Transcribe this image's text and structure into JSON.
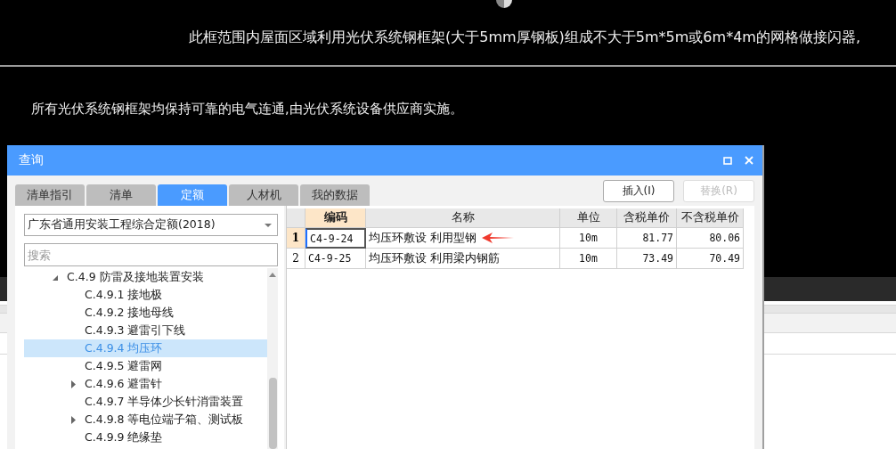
{
  "drawing": {
    "notes": [
      "此框范围内屋面区域利用光伏系统钢框架(大于5mm厚钢板)组成不大于5m*5m或6m*4m的网格做接闪器,",
      "所有光伏系统钢框架均保持可靠的电气连通,由光伏系统设备供应商实施。"
    ]
  },
  "dialog": {
    "title": "查询",
    "tabs": [
      {
        "label": "清单指引",
        "selected": false
      },
      {
        "label": "清单",
        "selected": false
      },
      {
        "label": "定额",
        "selected": true
      },
      {
        "label": "人材机",
        "selected": false
      },
      {
        "label": "我的数据",
        "selected": false
      }
    ],
    "buttons": [
      {
        "label": "插入(I)",
        "disabled": false
      },
      {
        "label": "替换(R)",
        "disabled": true
      }
    ],
    "library": {
      "value": "广东省通用安装工程综合定额(2018)"
    },
    "search": {
      "placeholder": "搜索"
    },
    "tree": [
      {
        "label": "C.4.9 防雷及接地装置安装",
        "expanded": true,
        "selected": false,
        "children": [
          {
            "label": "C.4.9.1 接地极",
            "selected": false
          },
          {
            "label": "C.4.9.2 接地母线",
            "selected": false
          },
          {
            "label": "C.4.9.3 避雷引下线",
            "selected": false
          },
          {
            "label": "C.4.9.4 均压环",
            "selected": true
          },
          {
            "label": "C.4.9.5 避雷网",
            "selected": false
          },
          {
            "label": "C.4.9.6 避雷针",
            "selected": false,
            "expanded": false
          },
          {
            "label": "C.4.9.7 半导体少长针消雷装置",
            "selected": false
          },
          {
            "label": "C.4.9.8 等电位端子箱、测试板",
            "selected": false,
            "expanded": false
          },
          {
            "label": "C.4.9.9 绝缘垫",
            "selected": false
          }
        ]
      }
    ],
    "table": {
      "columns": [
        "编码",
        "名称",
        "单位",
        "含税单价",
        "不含税单价"
      ],
      "rows": [
        {
          "number": "1",
          "cells": [
            "C4-9-24",
            "均压环敷设 利用型钢",
            "10m",
            "81.77",
            "80.06"
          ],
          "selected": true,
          "annotated": true
        },
        {
          "number": "2",
          "cells": [
            "C4-9-25",
            "均压环敷设 利用梁内钢筋",
            "10m",
            "73.49",
            "70.49"
          ],
          "selected": false,
          "annotated": false
        }
      ]
    }
  }
}
